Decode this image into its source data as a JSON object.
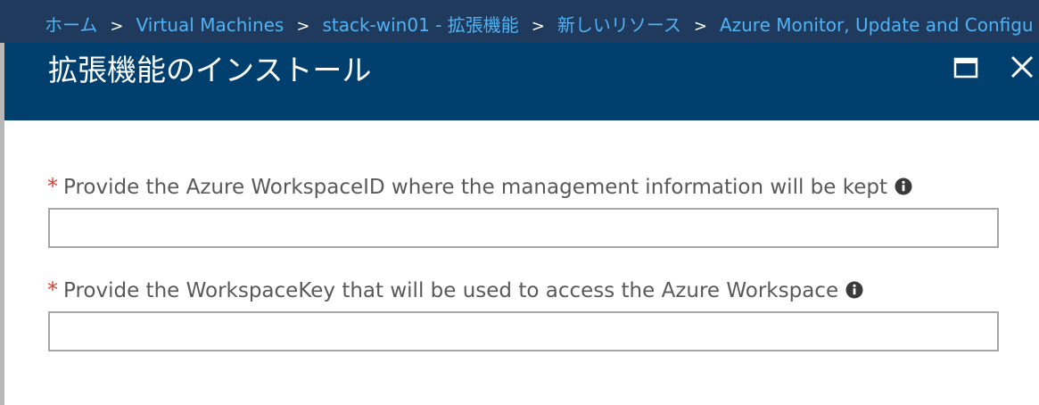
{
  "breadcrumb": {
    "items": [
      {
        "label": "ホーム"
      },
      {
        "label": "Virtual Machines"
      },
      {
        "label": "stack-win01 - 拡張機能"
      },
      {
        "label": "新しいリソース"
      },
      {
        "label": "Azure Monitor, Update and Configu"
      }
    ],
    "separator": ">"
  },
  "blade": {
    "title": "拡張機能のインストール",
    "maximize_icon": "maximize-icon",
    "close_icon": "close-icon"
  },
  "form": {
    "fields": [
      {
        "required_mark": "*",
        "label": "Provide the Azure WorkspaceID where the management information will be kept",
        "value": "",
        "info_icon": "info-icon"
      },
      {
        "required_mark": "*",
        "label": "Provide the WorkspaceKey that will be used to access the Azure Workspace",
        "value": "",
        "info_icon": "info-icon"
      }
    ]
  },
  "colors": {
    "breadcrumb_bg": "#1f3a5c",
    "header_bg": "#003f6e",
    "link": "#4fb3f6",
    "required": "#e03c31",
    "label_text": "#595959",
    "input_border": "#a6a6a6"
  }
}
